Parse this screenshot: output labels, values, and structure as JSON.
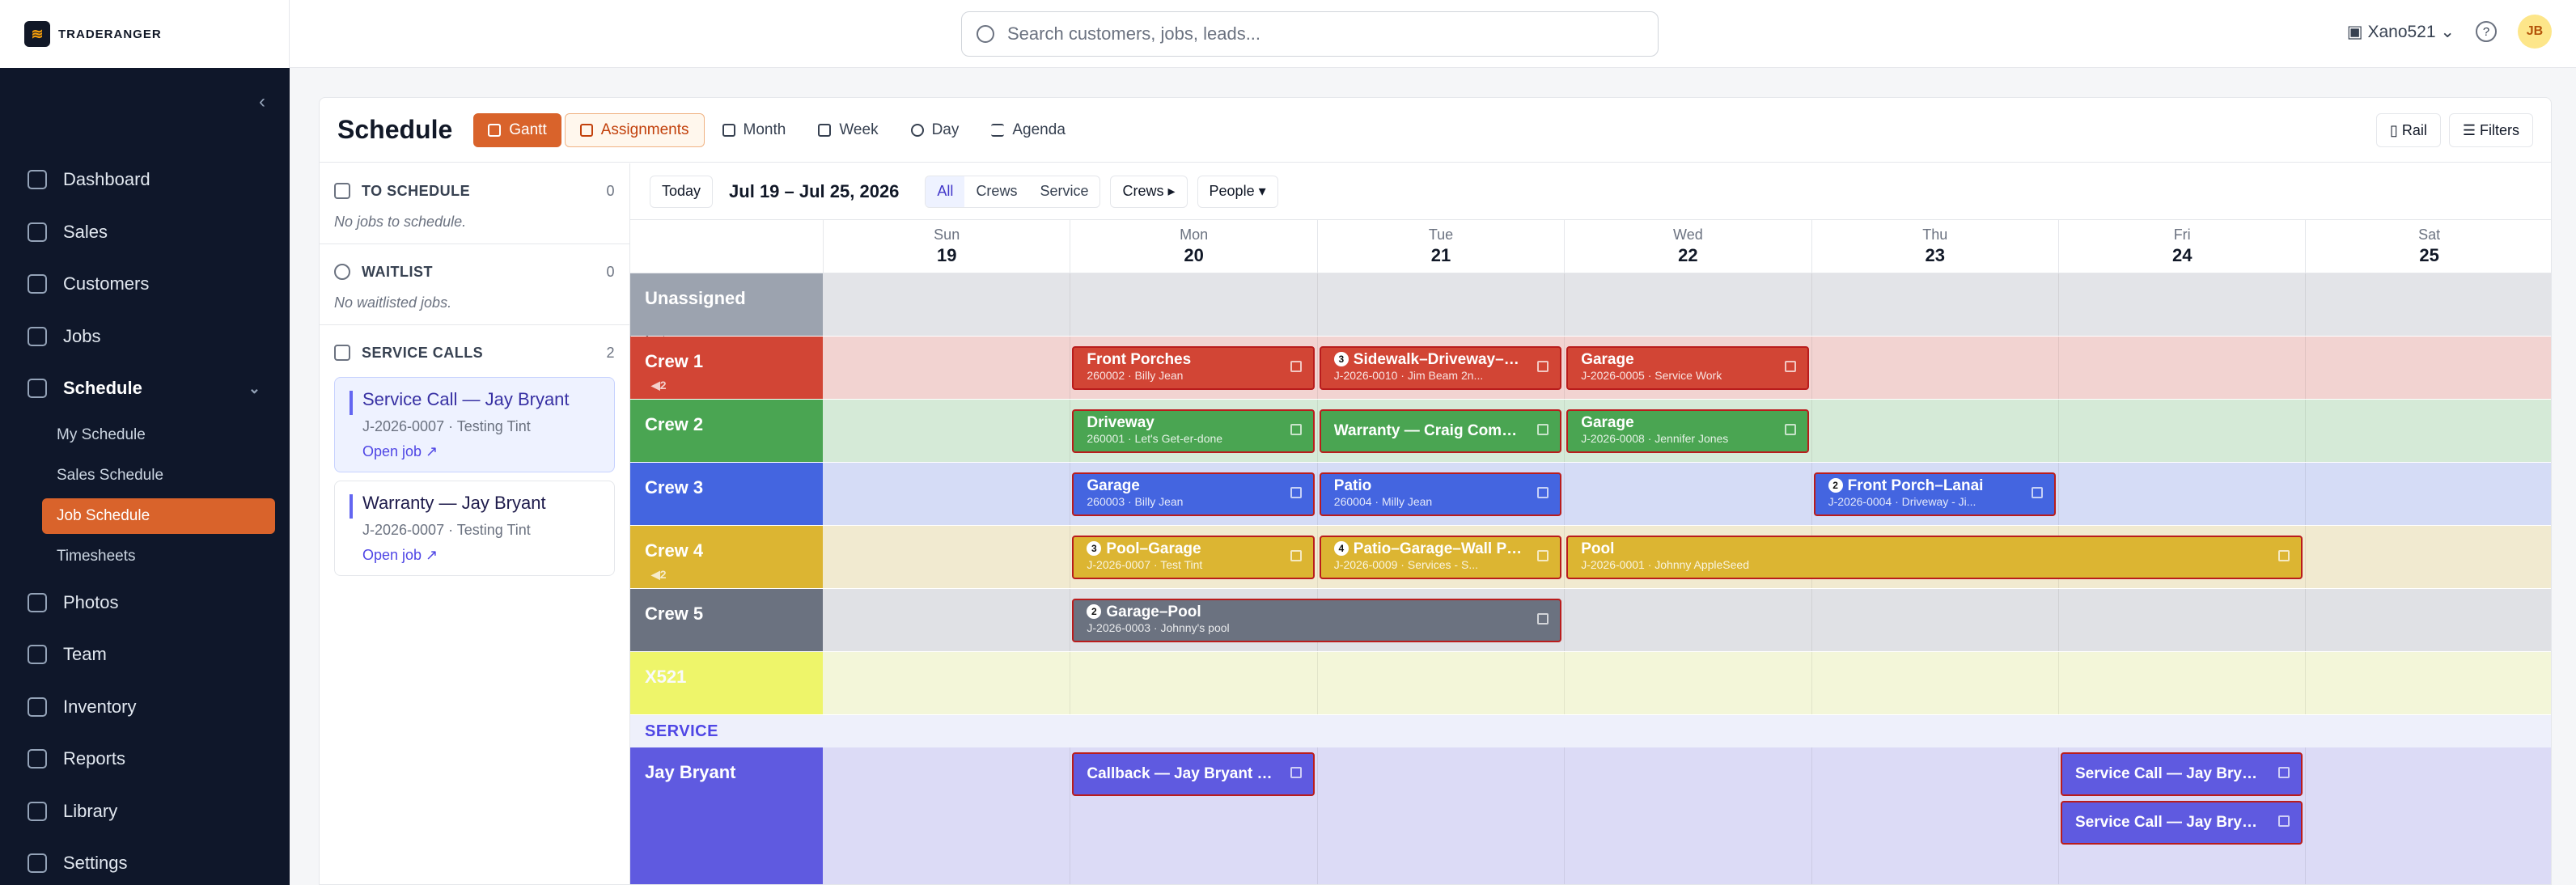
{
  "app": {
    "logo_text": "TRADERANGER",
    "logo_glyph": "≋"
  },
  "search": {
    "placeholder": "Search customers, jobs, leads..."
  },
  "topbar": {
    "account": "Xano521",
    "help": "?",
    "avatar": "JB"
  },
  "sidebar": {
    "collapse": "‹",
    "items": [
      {
        "label": "Dashboard",
        "icon": "home-icon"
      },
      {
        "label": "Sales",
        "icon": "trend-icon"
      },
      {
        "label": "Customers",
        "icon": "users-icon"
      },
      {
        "label": "Jobs",
        "icon": "briefcase-icon"
      },
      {
        "label": "Schedule",
        "icon": "calendar-icon"
      },
      {
        "label": "Photos",
        "icon": "camera-icon"
      },
      {
        "label": "Team",
        "icon": "team-icon"
      },
      {
        "label": "Inventory",
        "icon": "box-icon"
      },
      {
        "label": "Reports",
        "icon": "chart-icon"
      },
      {
        "label": "Library",
        "icon": "book-icon"
      },
      {
        "label": "Settings",
        "icon": "gear-icon"
      }
    ],
    "schedule_sub": [
      "My Schedule",
      "Sales Schedule",
      "Job Schedule",
      "Timesheets"
    ]
  },
  "header": {
    "title": "Schedule",
    "views": [
      "Gantt",
      "Assignments",
      "Month",
      "Week",
      "Day",
      "Agenda"
    ],
    "rail": "Rail",
    "filters": "Filters"
  },
  "left_panel": {
    "to_schedule": {
      "label": "TO SCHEDULE",
      "count": "0",
      "empty": "No jobs to schedule."
    },
    "waitlist": {
      "label": "WAITLIST",
      "count": "0",
      "empty": "No waitlisted jobs."
    },
    "service_calls": {
      "label": "SERVICE CALLS",
      "count": "2"
    },
    "cards": [
      {
        "title": "Service Call — Jay Bryant",
        "sub": "J-2026-0007 · Testing Tint",
        "link": "Open job ↗"
      },
      {
        "title": "Warranty — Jay Bryant",
        "sub": "J-2026-0007 · Testing Tint",
        "link": "Open job ↗"
      }
    ]
  },
  "toolbar": {
    "prev": "‹",
    "today": "Today",
    "next": "›",
    "range": "Jul 19 – Jul 25, 2026",
    "filter": [
      "All",
      "Crews",
      "Service"
    ],
    "crews": "Crews ▸",
    "people": "People ▾"
  },
  "days": [
    {
      "name": "Sun",
      "num": "19"
    },
    {
      "name": "Mon",
      "num": "20"
    },
    {
      "name": "Tue",
      "num": "21"
    },
    {
      "name": "Wed",
      "num": "22"
    },
    {
      "name": "Thu",
      "num": "23"
    },
    {
      "name": "Fri",
      "num": "24"
    },
    {
      "name": "Sat",
      "num": "25"
    }
  ],
  "rows": [
    {
      "label": "Unassigned",
      "color": "#9ca3af",
      "fill": "#e3e4e8"
    },
    {
      "label": "Crew 1",
      "color": "#d24535",
      "fill": "#f2d3d1",
      "mute": "◀2"
    },
    {
      "label": "Crew 2",
      "color": "#4aa552",
      "fill": "#d5ead7"
    },
    {
      "label": "Crew 3",
      "color": "#4465e0",
      "fill": "#d5dcf6"
    },
    {
      "label": "Crew 4",
      "color": "#dcb532",
      "fill": "#f1ead0",
      "mute": "◀2"
    },
    {
      "label": "Crew 5",
      "color": "#6b7280",
      "fill": "#e0e1e5"
    },
    {
      "label": "X521",
      "color": "#eef56a",
      "fill": "#f3f6d9"
    }
  ],
  "service_section": "SERVICE",
  "service_row": {
    "label": "Jay Bryant",
    "color": "#5f5ae0",
    "fill": "#dcdbf6"
  },
  "jobs": [
    {
      "row": 1,
      "day": 1,
      "span": 1,
      "title": "Front Porches",
      "sub": "260002 · Billy Jean",
      "color": "#d24535"
    },
    {
      "row": 1,
      "day": 2,
      "span": 1,
      "badge": "3",
      "title": "Sidewalk–Driveway–Sc...",
      "sub": "J-2026-0010 · Jim Beam 2n...",
      "color": "#d24535"
    },
    {
      "row": 1,
      "day": 3,
      "span": 1,
      "title": "Garage",
      "sub": "J-2026-0005 · Service Work",
      "color": "#d24535"
    },
    {
      "row": 2,
      "day": 1,
      "span": 1,
      "title": "Driveway",
      "sub": "260001 · Let's Get-er-done",
      "color": "#4aa552"
    },
    {
      "row": 2,
      "day": 2,
      "span": 1,
      "title": "Warranty — Craig Comea...",
      "sub": "",
      "color": "#4aa552"
    },
    {
      "row": 2,
      "day": 3,
      "span": 1,
      "title": "Garage",
      "sub": "J-2026-0008 · Jennifer Jones",
      "color": "#4aa552"
    },
    {
      "row": 3,
      "day": 1,
      "span": 1,
      "title": "Garage",
      "sub": "260003 · Billy Jean",
      "color": "#4465e0"
    },
    {
      "row": 3,
      "day": 2,
      "span": 1,
      "title": "Patio",
      "sub": "260004 · Milly Jean",
      "color": "#4465e0"
    },
    {
      "row": 3,
      "day": 4,
      "span": 1,
      "badge": "2",
      "title": "Front Porch–Lanai",
      "sub": "J-2026-0004 · Driveway - Ji...",
      "color": "#4465e0"
    },
    {
      "row": 4,
      "day": 1,
      "span": 1,
      "badge": "3",
      "title": "Pool–Garage",
      "sub": "J-2026-0007 · Test Tint",
      "color": "#dcb532"
    },
    {
      "row": 4,
      "day": 2,
      "span": 1,
      "badge": "4",
      "title": "Patio–Garage–Wall Pai...",
      "sub": "J-2026-0009 · Services - S...",
      "color": "#dcb532"
    },
    {
      "row": 4,
      "day": 3,
      "span": 3,
      "title": "Pool",
      "sub": "J-2026-0001 · Johnny AppleSeed",
      "color": "#dcb532"
    },
    {
      "row": 5,
      "day": 1,
      "span": 2,
      "badge": "2",
      "title": "Garage–Pool",
      "sub": "J-2026-0003 · Johnny's pool",
      "color": "#6b7280"
    }
  ],
  "service_jobs": [
    {
      "day": 1,
      "slot": 0,
      "title": "Callback — Jay Bryant —...",
      "color": "#5f5ae0"
    },
    {
      "day": 5,
      "slot": 0,
      "title": "Service Call — Jay Bryan...",
      "color": "#5f5ae0"
    },
    {
      "day": 5,
      "slot": 1,
      "title": "Service Call — Jay Bryan...",
      "color": "#5f5ae0"
    }
  ],
  "colors": {
    "accent": "#d9632b",
    "sidebar_bg": "#0f172a",
    "job_border": "#b91c1c"
  }
}
